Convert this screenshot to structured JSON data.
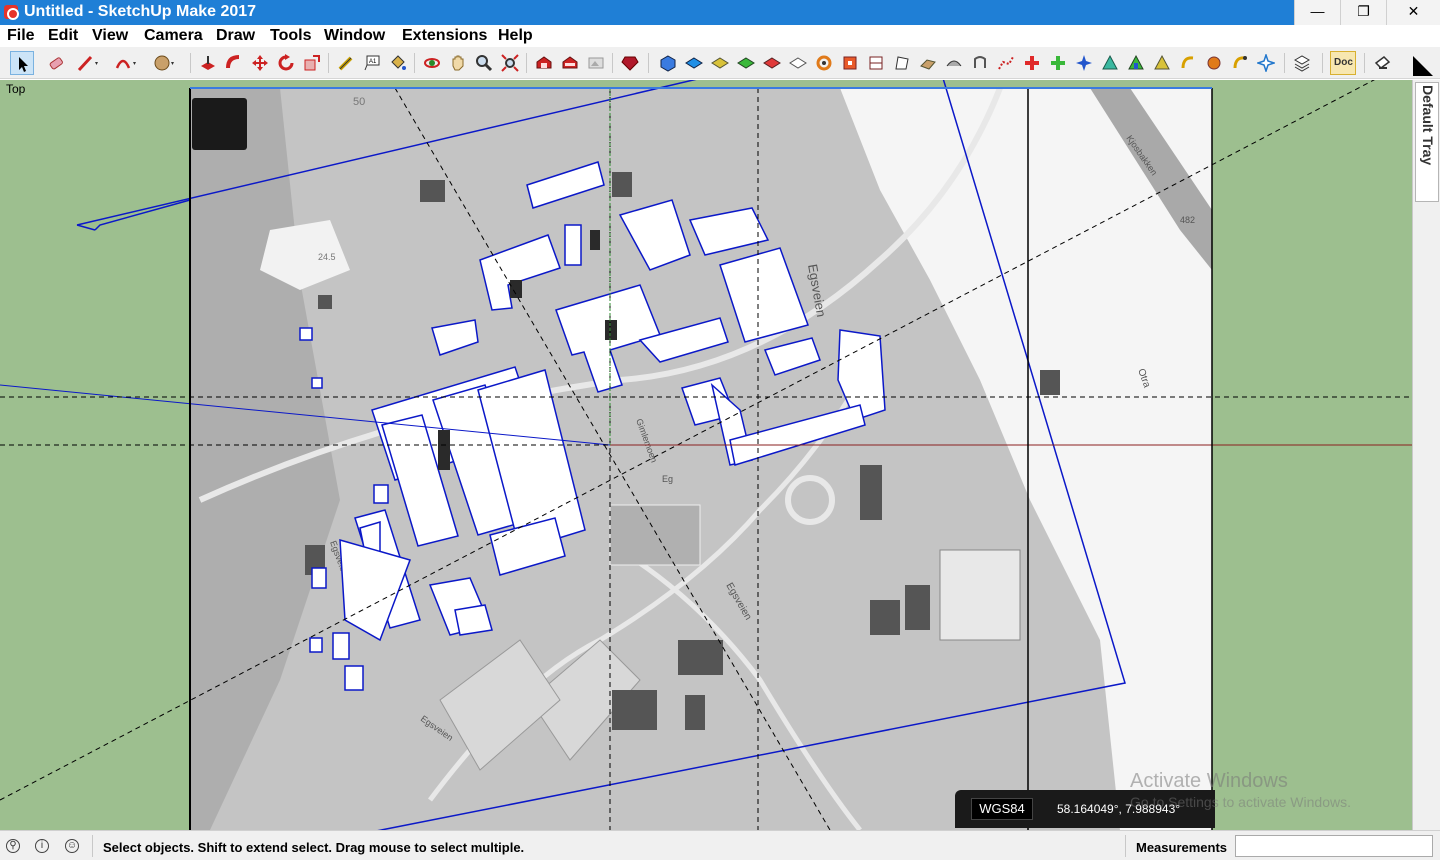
{
  "window": {
    "title": "Untitled - SketchUp Make 2017",
    "min_glyph": "—",
    "max_glyph": "❐",
    "close_glyph": "✕"
  },
  "menu": [
    "File",
    "Edit",
    "View",
    "Camera",
    "Draw",
    "Tools",
    "Window",
    "Extensions",
    "Help"
  ],
  "toolbar": {
    "tools": [
      "select-tool",
      "eraser-tool",
      "line-tool",
      "arc-tool",
      "shapes-tool",
      "push-pull-tool",
      "follow-me-tool",
      "move-tool",
      "rotate-tool",
      "scale-tool",
      "tape-measure-tool",
      "text-tool",
      "paint-bucket-tool",
      "orbit-tool",
      "pan-tool",
      "zoom-tool",
      "zoom-extents-tool",
      "warehouse-tool",
      "extension-warehouse-tool",
      "layout-tool",
      "ruby-tool",
      "iso-view",
      "top-view",
      "front-view",
      "right-view",
      "back-view",
      "left-view",
      "look-around-tool",
      "section-plane-tool",
      "section-display-tool",
      "sandbox-from-contours",
      "sandbox-from-scratch",
      "smoove-tool",
      "stamp-tool",
      "drape-tool",
      "add-detail-tool",
      "flip-edge-tool",
      "add-location",
      "toggle-terrain",
      "photo-textures",
      "geo-tool-1",
      "geo-tool-2",
      "geo-tool-3",
      "geo-tool-4",
      "geo-tool-5",
      "layers-tool",
      "doc-tool",
      "shadow-tool"
    ],
    "doc_label": "Doc"
  },
  "viewport": {
    "view_label": "Top",
    "colors": {
      "background": "#9dbf8f",
      "map": "#bdbdbd",
      "selection": "#0b18c8",
      "red_axis": "#8a1f1f",
      "green_axis": "#2e8b2e"
    },
    "geo": {
      "datum": "WGS84",
      "coords": "58.164049°, 7.988943°"
    },
    "map_labels": {
      "road_egsveien": "Egsveien",
      "road_eg": "Eg",
      "road_gimlemoen": "Gimlemoen",
      "river": "Otra",
      "route": "482",
      "road_kjos": "Kjosbakken",
      "contour": "50",
      "elev": "24.5"
    },
    "watermark": {
      "line1": "Activate Windows",
      "line2": "Go to Settings to activate Windows."
    }
  },
  "tray": {
    "label": "Default Tray"
  },
  "status": {
    "message": "Select objects. Shift to extend select. Drag mouse to select multiple.",
    "measurements_label": "Measurements",
    "measurements_value": ""
  }
}
